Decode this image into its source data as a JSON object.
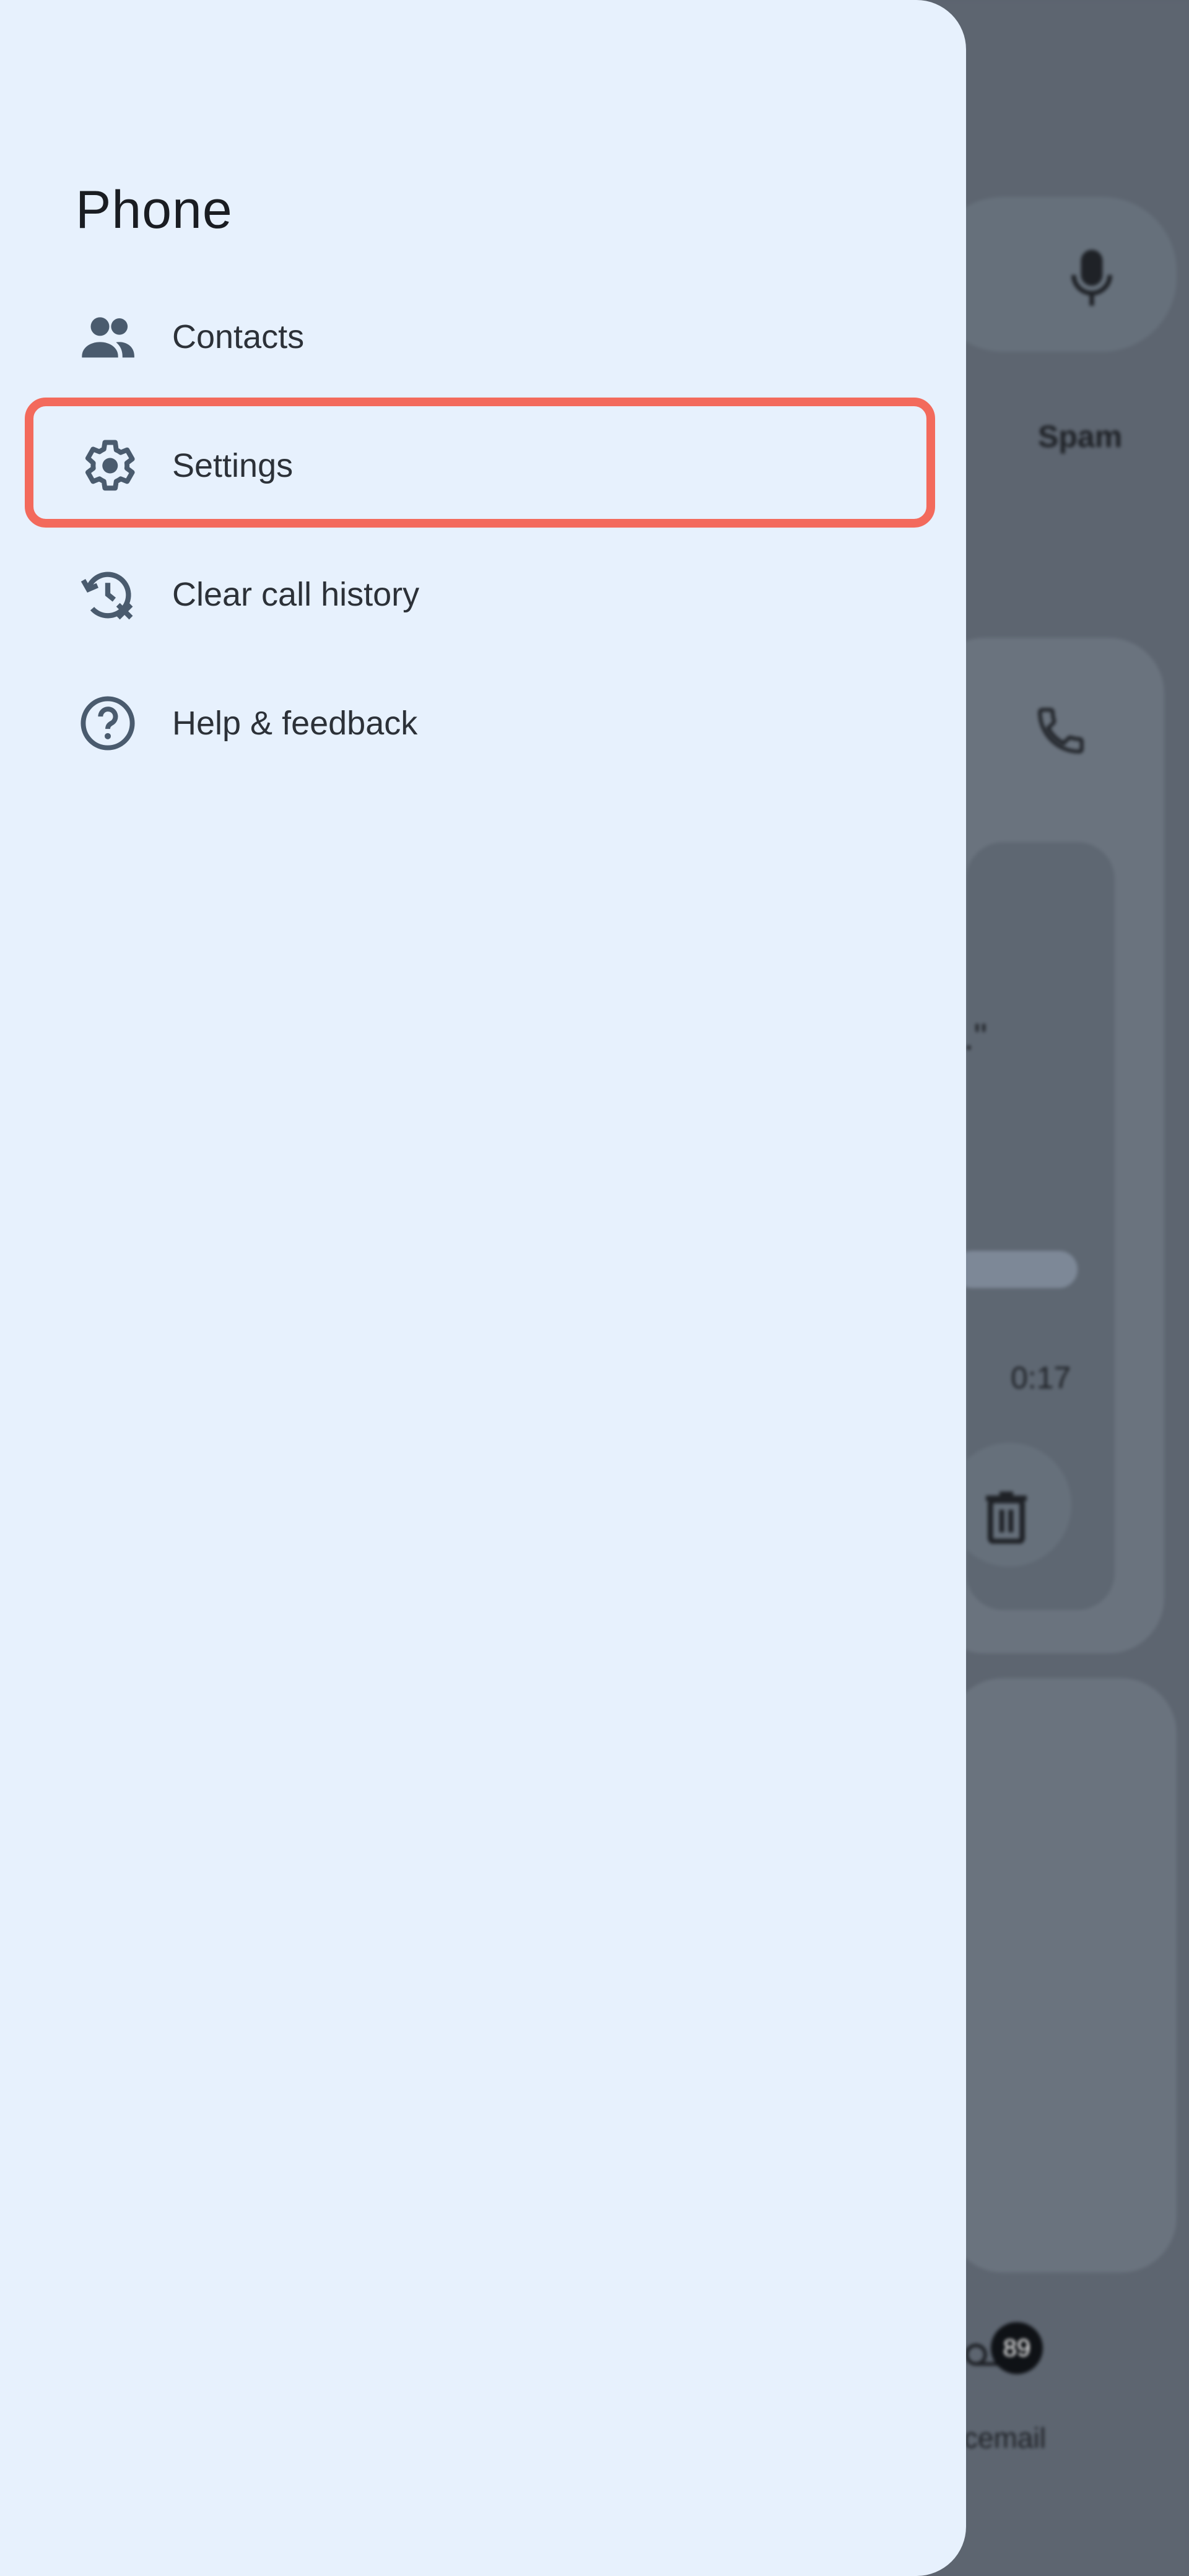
{
  "colors": {
    "drawer_background": "#e7f1fd",
    "highlight_outline": "#f36a5c",
    "icon": "#4a5b6e",
    "scrim": "#5d6570"
  },
  "drawer": {
    "title": "Phone",
    "items": [
      {
        "label": "Contacts",
        "icon": "people-icon"
      },
      {
        "label": "Settings",
        "icon": "gear-icon",
        "highlighted": true
      },
      {
        "label": "Clear call history",
        "icon": "clear-history-icon"
      },
      {
        "label": "Help & feedback",
        "icon": "help-icon"
      }
    ]
  },
  "background": {
    "tab_spam": "Spam",
    "duration": "0:17",
    "quote_fragment": ".\"",
    "voicemail_badge": "89",
    "voicemail_label": "cemail"
  }
}
